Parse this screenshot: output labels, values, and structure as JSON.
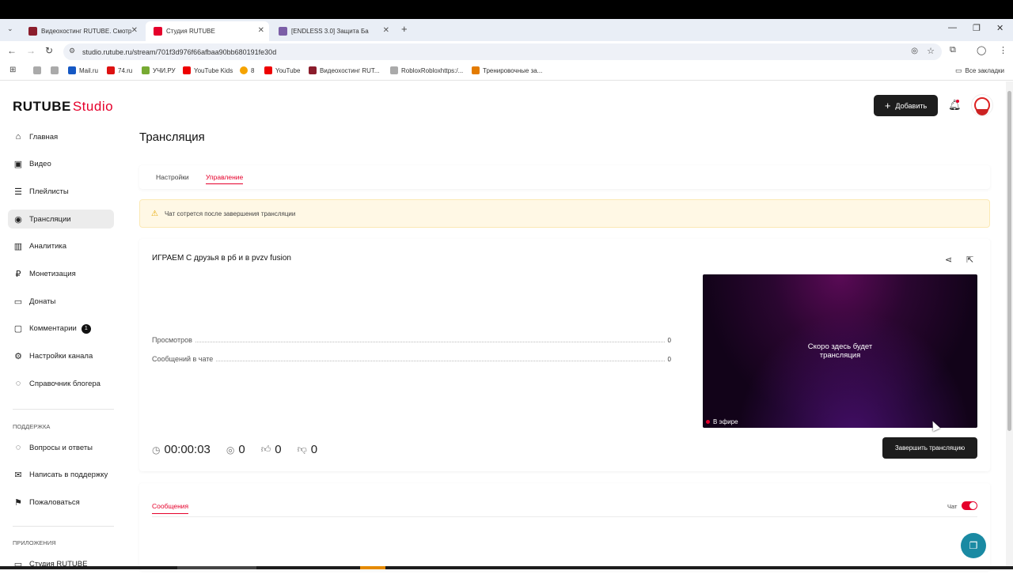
{
  "browser": {
    "tabs": [
      {
        "title": "Видеохостинг RUTUBE. Смотр",
        "active": false,
        "favicon_color": "#8b1d2c"
      },
      {
        "title": "Студия RUTUBE",
        "active": true,
        "favicon_color": "#e5002b"
      },
      {
        "title": "[ENDLESS 3.0] Защита Ба",
        "active": false,
        "favicon_color": "#7b5ea7"
      }
    ],
    "url": "studio.rutube.ru/stream/701f3d976f66afbaa90bb680191fe30d",
    "bookmarks": [
      {
        "label": "",
        "color": "#999"
      },
      {
        "label": "",
        "color": "#999"
      },
      {
        "label": "Mail.ru",
        "color": "#1558c4"
      },
      {
        "label": "74.ru",
        "color": "#d11"
      },
      {
        "label": "УЧИ.РУ",
        "color": "#7a3"
      },
      {
        "label": "YouTube Kids",
        "color": "#e00"
      },
      {
        "label": "8",
        "color": "#f5a300"
      },
      {
        "label": "YouTube",
        "color": "#e00"
      },
      {
        "label": "Видеохостинг RUT...",
        "color": "#8b1d2c"
      },
      {
        "label": "RobloxRobloxhttps:/...",
        "color": "#999"
      },
      {
        "label": "Тренировочные за...",
        "color": "#e37b00"
      }
    ],
    "all_bookmarks": "Все закладки"
  },
  "app": {
    "logo_main": "RUTUBE",
    "logo_studio": "Studio",
    "add_button": "Добавить",
    "sidebar": {
      "items": [
        {
          "label": "Главная",
          "icon": "home-icon",
          "glyph": "⌂"
        },
        {
          "label": "Видео",
          "icon": "video-icon",
          "glyph": "▣"
        },
        {
          "label": "Плейлисты",
          "icon": "playlist-icon",
          "glyph": "☰"
        },
        {
          "label": "Трансляции",
          "icon": "broadcast-icon",
          "glyph": "◉"
        },
        {
          "label": "Аналитика",
          "icon": "analytics-icon",
          "glyph": "▥"
        },
        {
          "label": "Монетизация",
          "icon": "monetization-icon",
          "glyph": "₽"
        },
        {
          "label": "Донаты",
          "icon": "donate-icon",
          "glyph": "▭"
        },
        {
          "label": "Комментарии",
          "icon": "comments-icon",
          "glyph": "▢",
          "badge": "1"
        },
        {
          "label": "Настройки канала",
          "icon": "settings-icon",
          "glyph": "⚙"
        },
        {
          "label": "Справочник блогера",
          "icon": "guide-icon",
          "glyph": "◌"
        }
      ],
      "support_title": "Поддержка",
      "support_items": [
        {
          "label": "Вопросы и ответы",
          "icon": "faq-icon",
          "glyph": "◌"
        },
        {
          "label": "Написать в поддержку",
          "icon": "mail-icon",
          "glyph": "✉"
        },
        {
          "label": "Пожаловаться",
          "icon": "flag-icon",
          "glyph": "⚑"
        }
      ],
      "apps_title": "Приложения",
      "apps_items": [
        {
          "label": "Студия RUTUBE",
          "icon": "studio-app-icon",
          "glyph": "▭"
        }
      ]
    },
    "page_title": "Трансляция",
    "tabs": {
      "settings": "Настройки",
      "control": "Управление"
    },
    "warning": "Чат сотрется после завершения трансляции",
    "stream": {
      "title": "ИГРАЕМ С друзья в рб и в pvzv fusion",
      "stats": [
        {
          "label": "Просмотров",
          "value": "0"
        },
        {
          "label": "Сообщений в чате",
          "value": "0"
        }
      ],
      "timer": "00:00:03",
      "viewers": "0",
      "likes": "0",
      "dislikes": "0",
      "preview_text_line1": "Скоро здесь будет",
      "preview_text_line2": "трансляция",
      "live_label": "В эфире",
      "end_button": "Завершить трансляцию"
    },
    "messages": {
      "tab": "Сообщения",
      "chat_label": "Чат",
      "chat_enabled": true
    }
  }
}
